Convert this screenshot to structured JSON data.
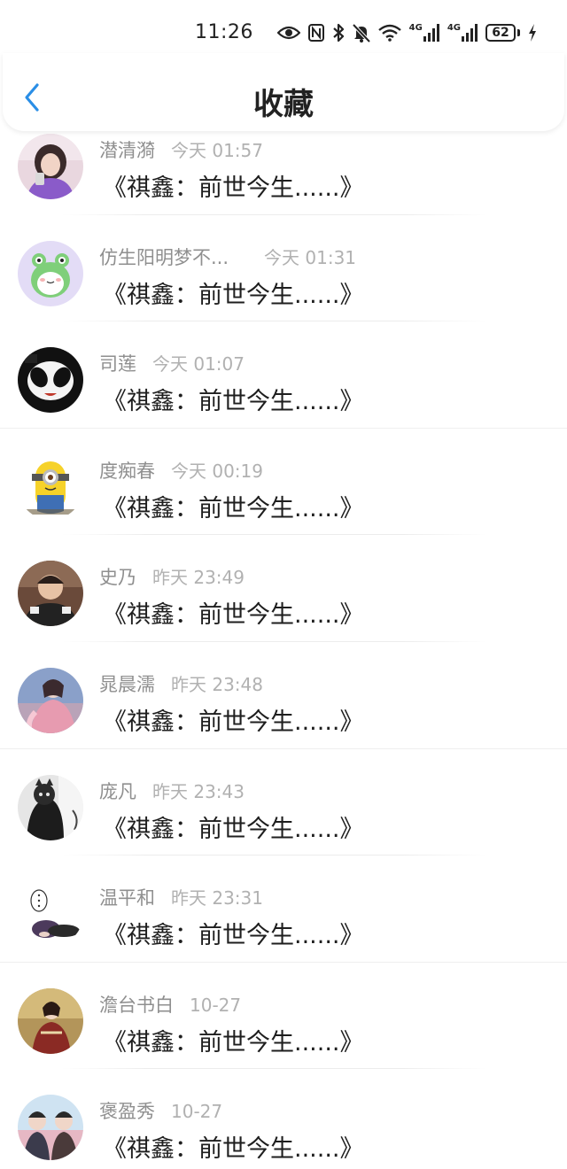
{
  "status_bar": {
    "time": "11:26",
    "battery": "62",
    "network_labels": [
      "4G",
      "4G"
    ],
    "icons": [
      "eye-icon",
      "nfc-icon",
      "bluetooth-icon",
      "bell-off-icon",
      "wifi-icon",
      "signal-icon",
      "signal-icon",
      "battery-icon",
      "charging-icon"
    ]
  },
  "nav": {
    "title": "收藏",
    "back_icon": "chevron-left-icon",
    "accent_color": "#2a8ee6"
  },
  "items": [
    {
      "name": "潜清漪",
      "time": "今天 01:57",
      "title": "《祺鑫：前世今生......》",
      "avatar": "girl-purple-hoodie-avatar"
    },
    {
      "name": "仿生阳明梦不...",
      "time": "今天 01:31",
      "title": "《祺鑫：前世今生......》",
      "avatar": "green-frog-avatar"
    },
    {
      "name": "司莲",
      "time": "今天 01:07",
      "title": "《祺鑫：前世今生......》",
      "avatar": "black-white-cartoon-avatar"
    },
    {
      "name": "度痴春",
      "time": "今天 00:19",
      "title": "《祺鑫：前世今生......》",
      "avatar": "minion-avatar"
    },
    {
      "name": "史乃",
      "time": "昨天 23:49",
      "title": "《祺鑫：前世今生......》",
      "avatar": "person-photo-avatar"
    },
    {
      "name": "晁晨濡",
      "time": "昨天 23:48",
      "title": "《祺鑫：前世今生......》",
      "avatar": "pink-dress-girl-avatar"
    },
    {
      "name": "庞凡",
      "time": "昨天 23:43",
      "title": "《祺鑫：前世今生......》",
      "avatar": "cat-photo-avatar"
    },
    {
      "name": "温平和",
      "time": "昨天 23:31",
      "title": "《祺鑫：前世今生......》",
      "avatar": "sleeping-character-avatar"
    },
    {
      "name": "澹台书白",
      "time": "10-27",
      "title": "《祺鑫：前世今生......》",
      "avatar": "costume-photo-avatar"
    },
    {
      "name": "褒盈秀",
      "time": "10-27",
      "title": "《祺鑫：前世今生......》",
      "avatar": "two-people-avatar"
    }
  ]
}
